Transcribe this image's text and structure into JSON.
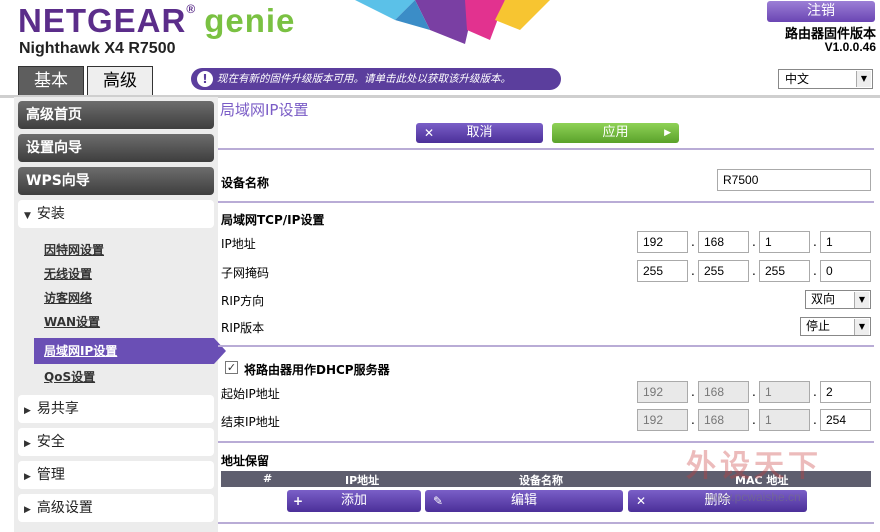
{
  "header": {
    "brand": "NETGEAR",
    "reg_mark": "®",
    "product": "genie",
    "model": "Nighthawk X4 R7500",
    "logout_label": "注销",
    "firmware_label": "路由器固件版本",
    "firmware_version": "V1.0.0.46",
    "tabs": [
      {
        "label": "基本"
      },
      {
        "label": "高级"
      }
    ],
    "update_notice": "现在有新的固件升级版本可用。请单击此处以获取该升级版本。",
    "notice_icon": "!",
    "language": "中文"
  },
  "sidebar": {
    "dark_items": [
      {
        "label": "高级首页"
      },
      {
        "label": "设置向导"
      },
      {
        "label": "WPS向导"
      }
    ],
    "setup_section": {
      "label": "安装",
      "arrow": "▼"
    },
    "setup_items": [
      {
        "label": "因特网设置"
      },
      {
        "label": "无线设置"
      },
      {
        "label": "访客网络"
      },
      {
        "label": "WAN设置"
      },
      {
        "label": "局域网IP设置"
      },
      {
        "label": "QoS设置"
      }
    ],
    "collapsed_sections": [
      {
        "label": "易共享",
        "arrow": "▶"
      },
      {
        "label": "安全",
        "arrow": "▶"
      },
      {
        "label": "管理",
        "arrow": "▶"
      },
      {
        "label": "高级设置",
        "arrow": "▶"
      }
    ]
  },
  "main": {
    "title": "局域网IP设置",
    "cancel_label": "取消",
    "apply_label": "应用",
    "device_name_label": "设备名称",
    "device_name_value": "R7500",
    "tcpip_heading": "局域网TCP/IP设置",
    "ip_label": "IP地址",
    "ip": [
      "192",
      "168",
      "1",
      "1"
    ],
    "mask_label": "子网掩码",
    "mask": [
      "255",
      "255",
      "255",
      "0"
    ],
    "rip_dir_label": "RIP方向",
    "rip_dir_value": "双向",
    "rip_ver_label": "RIP版本",
    "rip_ver_value": "停止",
    "dhcp_label": "将路由器用作DHCP服务器",
    "dhcp_checked": true,
    "start_ip_label": "起始IP地址",
    "start_ip": [
      "192",
      "168",
      "1",
      "2"
    ],
    "end_ip_label": "结束IP地址",
    "end_ip": [
      "192",
      "168",
      "1",
      "254"
    ],
    "reservation_heading": "地址保留",
    "table_headers": [
      "#",
      "IP地址",
      "设备名称",
      "MAC 地址"
    ],
    "add_label": "添加",
    "edit_label": "编辑",
    "delete_label": "删除"
  },
  "watermark": {
    "text": "外设天下",
    "url": "www.pcwaishe.cn"
  },
  "colors": {
    "brand_purple": "#5b2d8a",
    "genie_green": "#7ac142",
    "accent_purple": "#6a4fb5",
    "apply_green": "#6cb33a"
  }
}
